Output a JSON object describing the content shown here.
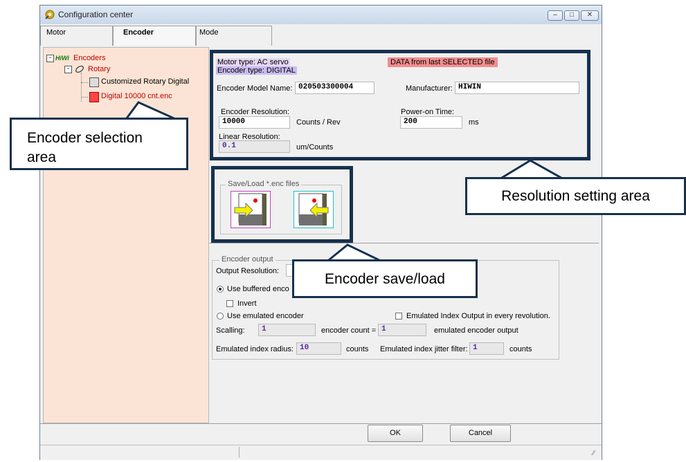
{
  "window": {
    "title": "Configuration center",
    "controls": [
      "minimize-icon",
      "maximize-icon",
      "close-icon"
    ]
  },
  "tabs": [
    {
      "label": "Motor",
      "active": false
    },
    {
      "label": "Encoder",
      "active": true
    },
    {
      "label": "Mode",
      "active": false
    }
  ],
  "tree": {
    "logo": "HiWi",
    "root": "Encoders",
    "group": "Rotary",
    "items": [
      "Customized Rotary Digital",
      "Digital 10000 cnt.enc"
    ]
  },
  "header": {
    "motor_type": "Motor  type: AC servo",
    "encoder_type": "Encoder type: DIGITAL",
    "data_banner": "DATA from last SELECTED file"
  },
  "fields": {
    "model_name_label": "Encoder Model Name:",
    "model_name_value": "020503300004",
    "manufacturer_label": "Manufacturer:",
    "manufacturer_value": "HIWIN",
    "resolution_label": "Encoder Resolution:",
    "resolution_value": "10000",
    "resolution_unit": "Counts / Rev",
    "poweron_label": "Power-on Time:",
    "poweron_value": "200",
    "poweron_unit": "ms",
    "linear_label": "Linear Resolution:",
    "linear_value": "0.1",
    "linear_unit": "um/Counts"
  },
  "saveload": {
    "group_title": "Save/Load *.enc files"
  },
  "output": {
    "group_title": "Encoder output",
    "output_resolution_label": "Output Resolution:",
    "buffered_label": "Use buffered enco",
    "invert_label": "Invert",
    "emulated_label": "Use emulated encoder",
    "emulated_index_label": "Emulated Index Output in every revolution.",
    "scalling_label": "Scalling:",
    "scalling_value": "1",
    "encoder_count_label": "encoder count =",
    "encoder_count_value": "1",
    "emulated_output_label": "emulated encoder output",
    "index_radius_label": "Emulated index radius:",
    "index_radius_value": "10",
    "index_radius_unit": "counts",
    "jitter_label": "Emulated index jitter filter:",
    "jitter_value": "1",
    "jitter_unit": "counts"
  },
  "buttons": {
    "ok": "OK",
    "cancel": "Cancel"
  },
  "callouts": {
    "selection_line1": "Encoder selection",
    "selection_line2": "area",
    "resolution": "Resolution setting area",
    "saveload": "Encoder save/load"
  },
  "colors": {
    "callout_border": "#17314d",
    "tree_bg": "#fbe4d5",
    "banner_red": "#f08080",
    "type_bg": "#d9c8f0"
  }
}
